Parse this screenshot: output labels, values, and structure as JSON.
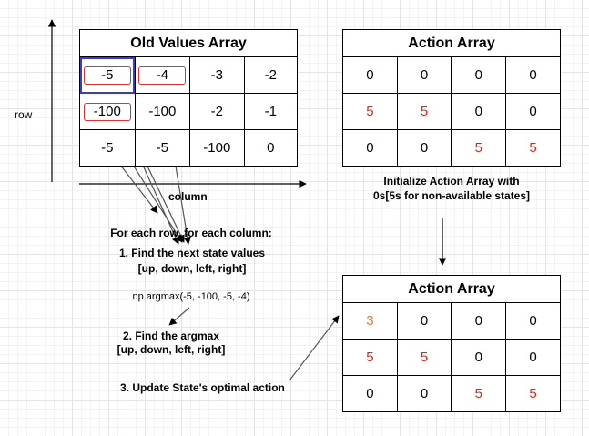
{
  "labels": {
    "row_axis": "row",
    "column_axis": "column",
    "init_note_line1": "Initialize Action Array with",
    "init_note_line2": "0s[5s for non-available states]",
    "for_each": "For each row, for each column:",
    "step1_line1": "1. Find the next state values",
    "step1_line2": "[up, down, left, right]",
    "argmax_call": "np.argmax(-5, -100, -5, -4)",
    "step2_line1": "2. Find the argmax",
    "step2_line2": "[up, down, left, right]",
    "step3": "3. Update State's optimal action"
  },
  "old_values": {
    "title": "Old Values Array",
    "rows": [
      [
        "-5",
        "-4",
        "-3",
        "-2"
      ],
      [
        "-100",
        "-100",
        "-2",
        "-1"
      ],
      [
        "-5",
        "-5",
        "-100",
        "0"
      ]
    ]
  },
  "action_initial": {
    "title": "Action Array",
    "rows": [
      [
        "0",
        "0",
        "0",
        "0"
      ],
      [
        "5",
        "5",
        "0",
        "0"
      ],
      [
        "0",
        "0",
        "5",
        "5"
      ]
    ]
  },
  "action_updated": {
    "title": "Action Array",
    "rows": [
      [
        "3",
        "0",
        "0",
        "0"
      ],
      [
        "5",
        "5",
        "0",
        "0"
      ],
      [
        "0",
        "0",
        "5",
        "5"
      ]
    ]
  },
  "colors": {
    "highlight_box": "#e03030",
    "selected_cell": "#3a3ad0",
    "value_five": "#e8201a",
    "updated_value": "#e8742a"
  }
}
